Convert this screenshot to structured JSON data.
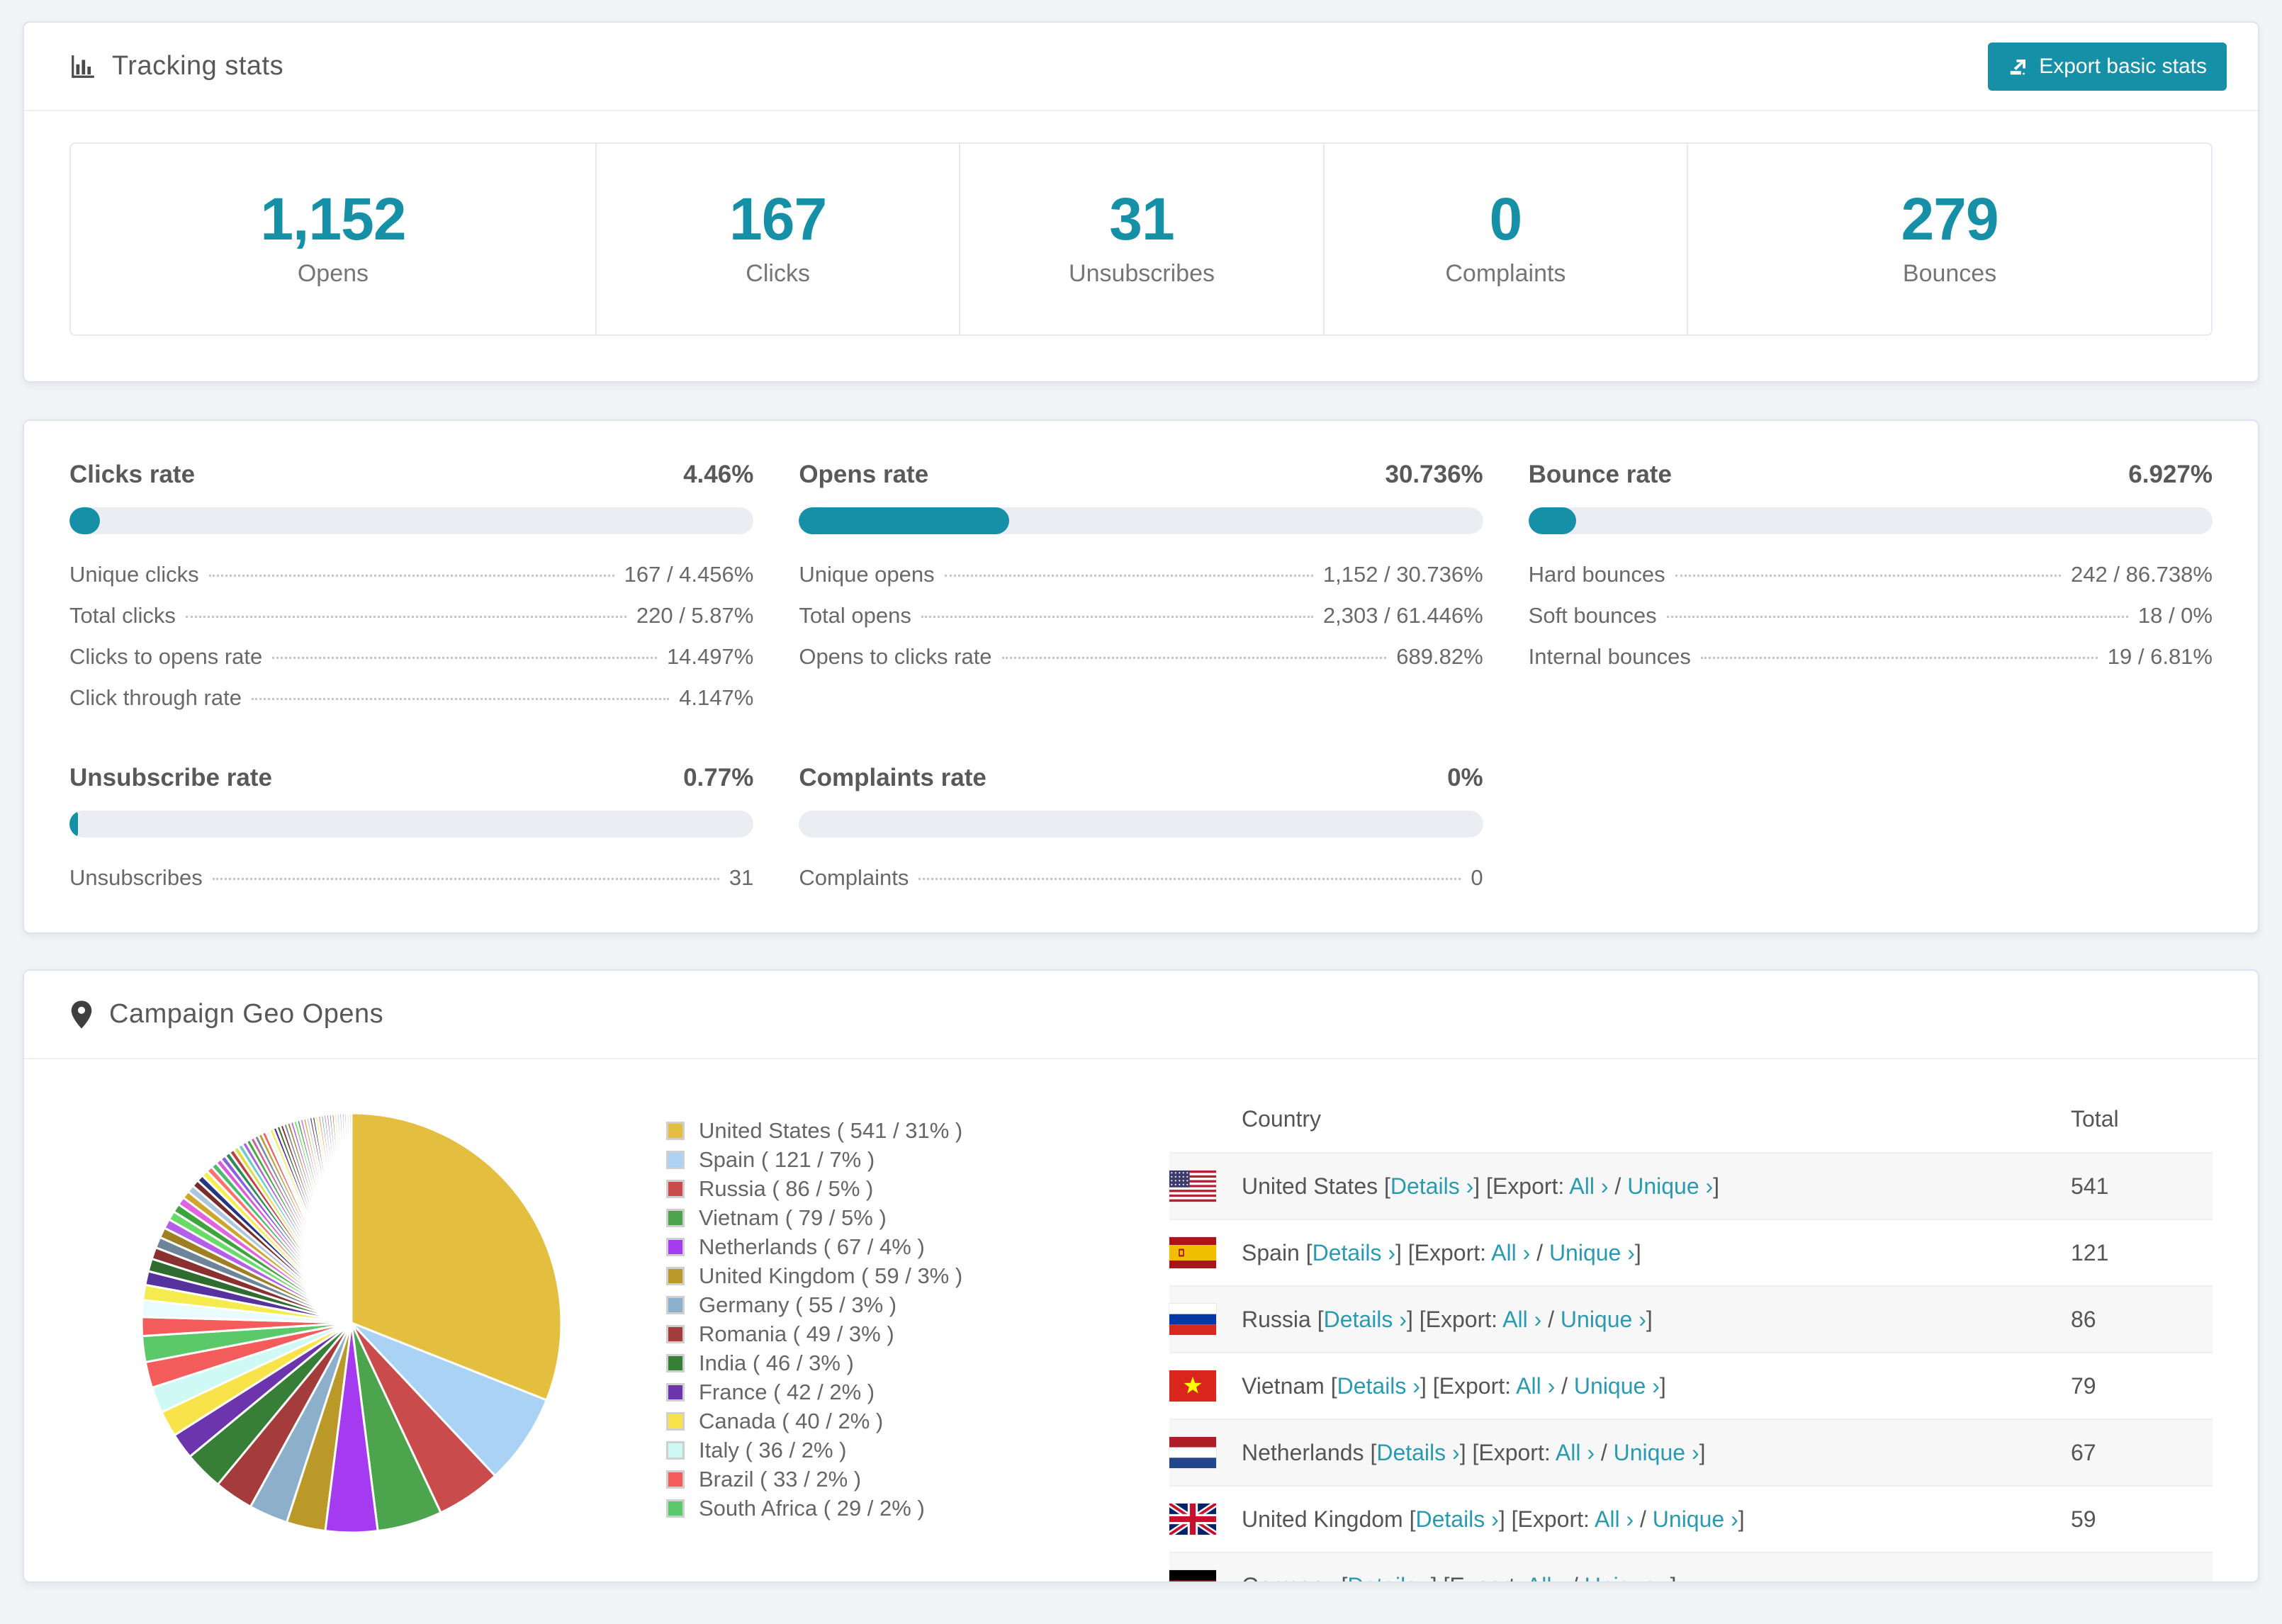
{
  "colors": {
    "accent": "#1590a6",
    "link": "#2a9ab1",
    "card_border": "#dfe3ec",
    "page_bg": "#f3f4f6",
    "row_stripe": "#f7f7f8"
  },
  "icons": {
    "tracking": "bar-chart-icon",
    "export": "export-icon",
    "geo": "map-pin-icon"
  },
  "tracking": {
    "title": "Tracking stats",
    "export_button": "Export basic stats",
    "stats": [
      {
        "value": "1,152",
        "label": "Opens"
      },
      {
        "value": "167",
        "label": "Clicks"
      },
      {
        "value": "31",
        "label": "Unsubscribes"
      },
      {
        "value": "0",
        "label": "Complaints"
      },
      {
        "value": "279",
        "label": "Bounces"
      }
    ]
  },
  "rates": {
    "blocks": [
      {
        "title": "Clicks rate",
        "value": "4.46%",
        "percent": 4.46,
        "rows": [
          {
            "label": "Unique clicks",
            "value": "167 / 4.456%"
          },
          {
            "label": "Total clicks",
            "value": "220 / 5.87%"
          },
          {
            "label": "Clicks to opens rate",
            "value": "14.497%"
          },
          {
            "label": "Click through rate",
            "value": "4.147%"
          }
        ]
      },
      {
        "title": "Opens rate",
        "value": "30.736%",
        "percent": 30.736,
        "rows": [
          {
            "label": "Unique opens",
            "value": "1,152 / 30.736%"
          },
          {
            "label": "Total opens",
            "value": "2,303 / 61.446%"
          },
          {
            "label": "Opens to clicks rate",
            "value": "689.82%"
          }
        ]
      },
      {
        "title": "Bounce rate",
        "value": "6.927%",
        "percent": 6.927,
        "rows": [
          {
            "label": "Hard bounces",
            "value": "242 / 86.738%"
          },
          {
            "label": "Soft bounces",
            "value": "18 / 0%"
          },
          {
            "label": "Internal bounces",
            "value": "19 / 6.81%"
          }
        ]
      },
      {
        "title": "Unsubscribe rate",
        "value": "0.77%",
        "percent": 0.77,
        "rows": [
          {
            "label": "Unsubscribes",
            "value": "31"
          }
        ]
      },
      {
        "title": "Complaints rate",
        "value": "0%",
        "percent": 0,
        "rows": [
          {
            "label": "Complaints",
            "value": "0"
          }
        ]
      }
    ]
  },
  "geo": {
    "title": "Campaign Geo Opens",
    "table": {
      "headers": {
        "country": "Country",
        "total": "Total"
      },
      "details_label": "Details ›",
      "export_prefix": "[Export:",
      "all_label": "All ›",
      "slash": " / ",
      "unique_label": "Unique ›",
      "rows": [
        {
          "country": "United States",
          "flag": "us",
          "total": "541"
        },
        {
          "country": "Spain",
          "flag": "es",
          "total": "121"
        },
        {
          "country": "Russia",
          "flag": "ru",
          "total": "86"
        },
        {
          "country": "Vietnam",
          "flag": "vn",
          "total": "79"
        },
        {
          "country": "Netherlands",
          "flag": "nl",
          "total": "67"
        },
        {
          "country": "United Kingdom",
          "flag": "gb",
          "total": "59"
        },
        {
          "country": "Germany",
          "flag": "de",
          "total": ""
        }
      ]
    }
  },
  "chart_data": {
    "type": "pie",
    "title": "Campaign Geo Opens",
    "legend_position": "right",
    "start_angle_deg": -90,
    "direction": "clockwise",
    "series": [
      {
        "name": "United States",
        "value": 541,
        "percent": 31,
        "color": "#E3BE3F",
        "legend_label": "United States ( 541 / 31% )"
      },
      {
        "name": "Spain",
        "value": 121,
        "percent": 7,
        "color": "#A9D2F5",
        "legend_label": "Spain ( 121 / 7% )"
      },
      {
        "name": "Russia",
        "value": 86,
        "percent": 5,
        "color": "#C94B4B",
        "legend_label": "Russia ( 86 / 5% )"
      },
      {
        "name": "Vietnam",
        "value": 79,
        "percent": 5,
        "color": "#4CA44C",
        "legend_label": "Vietnam ( 79 / 5% )"
      },
      {
        "name": "Netherlands",
        "value": 67,
        "percent": 4,
        "color": "#A43BF0",
        "legend_label": "Netherlands ( 67 / 4% )"
      },
      {
        "name": "United Kingdom",
        "value": 59,
        "percent": 3,
        "color": "#BB9928",
        "legend_label": "United Kingdom ( 59 / 3% )"
      },
      {
        "name": "Germany",
        "value": 55,
        "percent": 3,
        "color": "#8CAFCB",
        "legend_label": "Germany ( 55 / 3% )"
      },
      {
        "name": "Romania",
        "value": 49,
        "percent": 3,
        "color": "#A43C3C",
        "legend_label": "Romania ( 49 / 3% )"
      },
      {
        "name": "India",
        "value": 46,
        "percent": 3,
        "color": "#377E37",
        "legend_label": "India ( 46 / 3% )"
      },
      {
        "name": "France",
        "value": 42,
        "percent": 2,
        "color": "#6C35AD",
        "legend_label": "France ( 42 / 2% )"
      },
      {
        "name": "Canada",
        "value": 40,
        "percent": 2,
        "color": "#F9E34B",
        "legend_label": "Canada ( 40 / 2% )"
      },
      {
        "name": "Italy",
        "value": 36,
        "percent": 2,
        "color": "#CFF9F5",
        "legend_label": "Italy ( 36 / 2% )"
      },
      {
        "name": "Brazil",
        "value": 33,
        "percent": 2,
        "color": "#F45B5B",
        "legend_label": "Brazil ( 33 / 2% )"
      },
      {
        "name": "South Africa",
        "value": 29,
        "percent": 2,
        "color": "#5BC969",
        "legend_label": "South Africa ( 29 / 2% )"
      }
    ],
    "other_slices": {
      "note": "long tail of unlabeled small countries",
      "total_percent": 26,
      "slice_count": 60,
      "decay": 0.12,
      "palette": [
        "#F45B5B",
        "#E8FBFF",
        "#F6EB4E",
        "#56329F",
        "#2F6C2F",
        "#8B3030",
        "#6E8498",
        "#9F7F23",
        "#B45FE8",
        "#67DA67",
        "#3EA43E",
        "#E063E0",
        "#CFA62A",
        "#ABC6DE",
        "#7C2B2B",
        "#24367F",
        "#F4ef4E",
        "#FF7070",
        "#49BD6B",
        "#DC58DC",
        "#8860E0",
        "#2E8B57",
        "#C04040",
        "#DDDD44",
        "#66CCCC",
        "#AA66DD",
        "#44AA44",
        "#CC6699",
        "#7788AA",
        "#BBA033"
      ]
    }
  }
}
